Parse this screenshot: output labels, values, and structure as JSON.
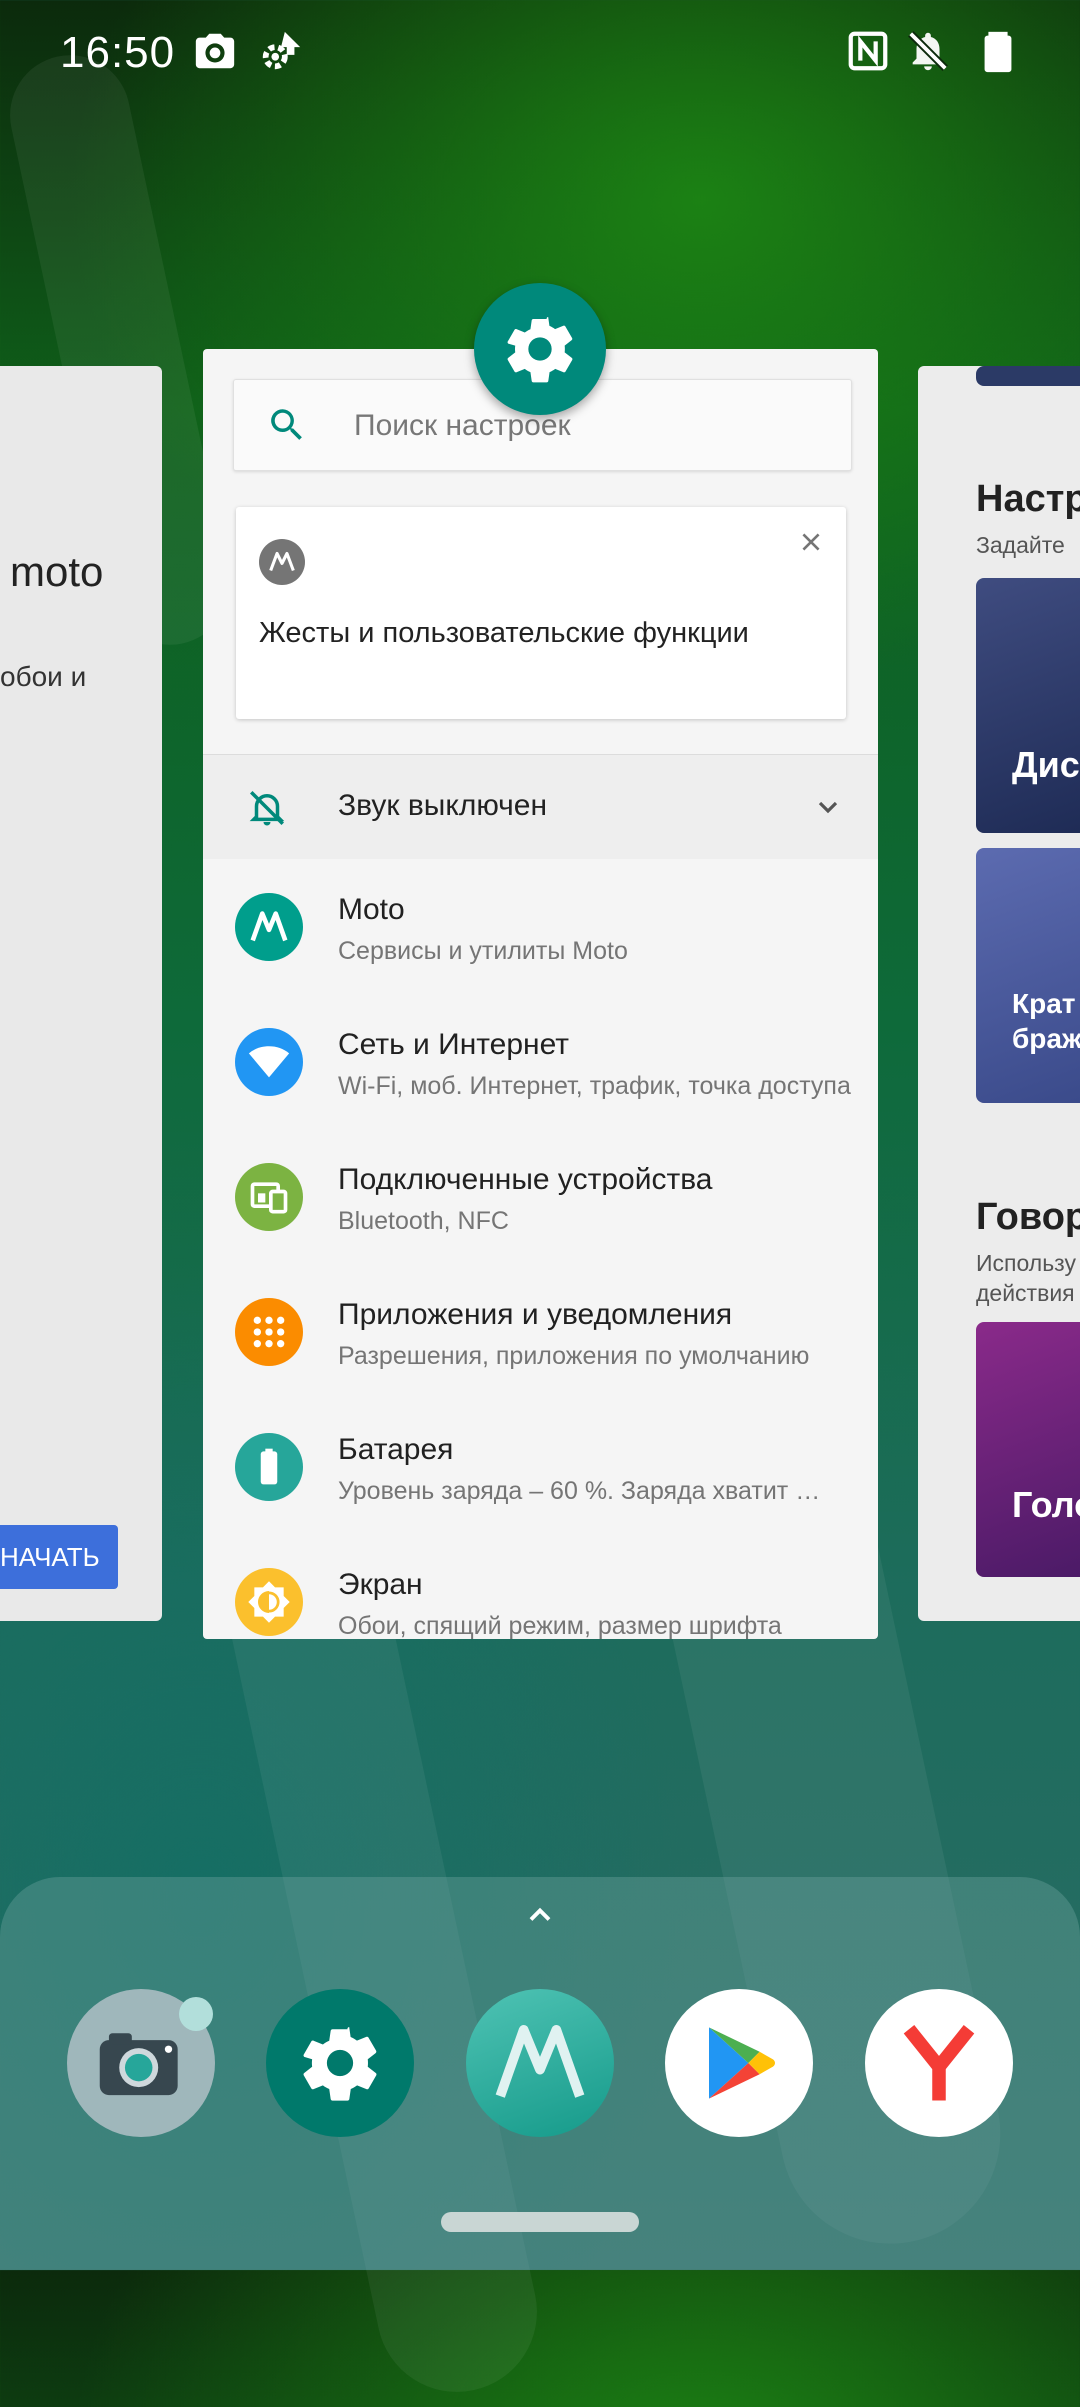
{
  "status_bar": {
    "time": "16:50"
  },
  "left_card": {
    "heading": "moto",
    "text": "обои и",
    "button": "НАЧАТЬ"
  },
  "right_card": {
    "section1_title": "Настр",
    "section1_sub": "Задайте",
    "tile1_label": "Дис",
    "tile2_label_1": "Крат",
    "tile2_label_2": "браж",
    "section2_title": "Говор",
    "section2_sub_1": "Использу",
    "section2_sub_2": "действия",
    "tile3_label": "Голо"
  },
  "settings": {
    "search_placeholder": "Поиск настроек",
    "suggestion_title": "Жесты и пользовательские функции",
    "sound_label": "Звук выключен",
    "items": [
      {
        "title": "Moto",
        "subtitle": "Сервисы и утилиты Moto",
        "icon": "moto-logo-icon",
        "color": "#009e8c"
      },
      {
        "title": "Сеть и Интернет",
        "subtitle": "Wi-Fi, моб. Интернет, трафик, точка доступа",
        "icon": "wifi-icon",
        "color": "#2196f3"
      },
      {
        "title": "Подключенные устройства",
        "subtitle": "Bluetooth, NFC",
        "icon": "devices-icon",
        "color": "#7cb342"
      },
      {
        "title": "Приложения и уведомления",
        "subtitle": "Разрешения, приложения по умолчанию",
        "icon": "apps-grid-icon",
        "color": "#fb8c00"
      },
      {
        "title": "Батарея",
        "subtitle": "Уровень заряда – 60 %. Заряда хватит …",
        "icon": "battery-icon",
        "color": "#26a69a"
      },
      {
        "title": "Экран",
        "subtitle": "Обои, спящий режим, размер шрифта",
        "icon": "brightness-icon",
        "color": "#fbc02d"
      }
    ]
  },
  "dock": {
    "apps": [
      "camera-app-icon",
      "settings-app-icon",
      "moto-app-icon",
      "play-store-icon",
      "yandex-icon"
    ]
  }
}
